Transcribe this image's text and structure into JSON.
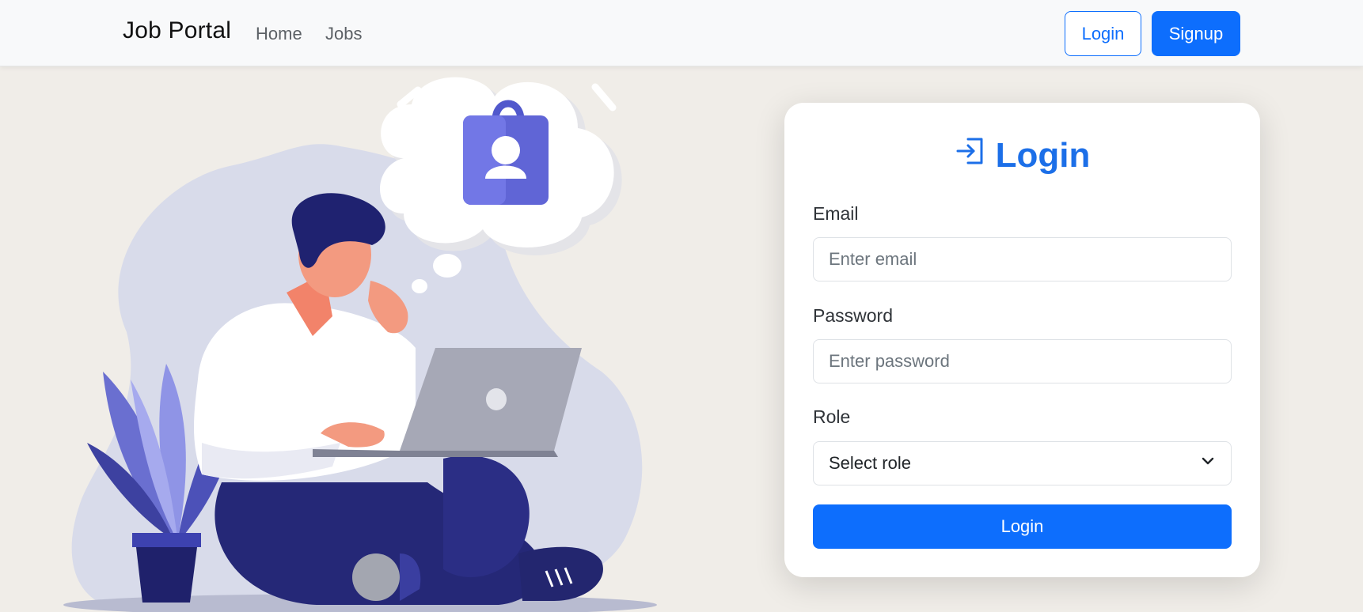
{
  "navbar": {
    "brand": "Job Portal",
    "links": [
      {
        "label": "Home"
      },
      {
        "label": "Jobs"
      }
    ],
    "login_label": "Login",
    "signup_label": "Signup"
  },
  "login_card": {
    "title": "Login",
    "email": {
      "label": "Email",
      "placeholder": "Enter email",
      "value": ""
    },
    "password": {
      "label": "Password",
      "placeholder": "Enter password",
      "value": ""
    },
    "role": {
      "label": "Role",
      "selected": "Select role"
    },
    "submit_label": "Login"
  },
  "icons": {
    "title_icon": "login-arrow-icon",
    "select_icon": "chevron-down-icon"
  },
  "colors": {
    "primary": "#0d6efd",
    "title": "#1c6fe8",
    "background": "#f0ede8",
    "navbar": "#f8f9fa"
  }
}
